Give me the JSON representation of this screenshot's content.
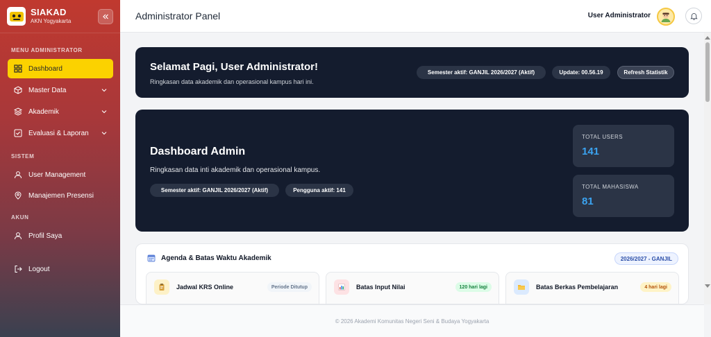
{
  "brand": {
    "title": "SIAKAD",
    "subtitle": "AKN Yogyakarta"
  },
  "sidebar": {
    "sections": [
      {
        "label": "MENU ADMINISTRATOR"
      },
      {
        "label": "SISTEM"
      },
      {
        "label": "AKUN"
      }
    ],
    "items": [
      {
        "label": "Dashboard",
        "icon": "grid-icon",
        "active": true
      },
      {
        "label": "Master Data",
        "icon": "box-icon",
        "expandable": true
      },
      {
        "label": "Akademik",
        "icon": "layers-icon",
        "expandable": true
      },
      {
        "label": "Evaluasi & Laporan",
        "icon": "checkbox-icon",
        "expandable": true
      },
      {
        "label": "User Management",
        "icon": "user-icon"
      },
      {
        "label": "Manajemen Presensi",
        "icon": "location-pin-icon"
      },
      {
        "label": "Profil Saya",
        "icon": "user-icon"
      },
      {
        "label": "Logout",
        "icon": "logout-icon"
      }
    ]
  },
  "header": {
    "title": "Administrator Panel",
    "user": "User Administrator"
  },
  "greeting": {
    "title": "Selamat Pagi, User Administrator!",
    "subtitle": "Ringkasan data akademik dan operasional kampus hari ini.",
    "semester": "Semester aktif: GANJIL 2026/2027 (Aktif)",
    "update": "Update: 00.56.19",
    "refresh_label": "Refresh Statistik"
  },
  "dashboard": {
    "title": "Dashboard Admin",
    "subtitle": "Ringkasan data inti akademik dan operasional kampus.",
    "semester": "Semester aktif: GANJIL 2026/2027 (Aktif)",
    "active_users": "Pengguna aktif: 141",
    "stats": [
      {
        "label": "TOTAL USERS",
        "value": "141"
      },
      {
        "label": "TOTAL MAHASISWA",
        "value": "81"
      }
    ]
  },
  "agenda": {
    "title": "Agenda & Batas Waktu Akademik",
    "badge": "2026/2027 - GANJIL",
    "items": [
      {
        "title": "Jadwal KRS Online",
        "tag": "Periode Ditutup",
        "tag_color": "#64748b",
        "tag_bg": "#f1f5f9",
        "icon_bg": "#fdf1c7"
      },
      {
        "title": "Batas Input Nilai",
        "tag": "120 hari lagi",
        "tag_color": "#15803d",
        "tag_bg": "#dcfce7",
        "icon_bg": "#fde2e4"
      },
      {
        "title": "Batas Berkas Pembelajaran",
        "tag": "4 hari lagi",
        "tag_color": "#b45309",
        "tag_bg": "#fef3c7",
        "icon_bg": "#dbeafe"
      }
    ]
  },
  "footer": {
    "text": "© 2026 Akademi Komunitas Negeri Seni & Budaya Yogyakarta"
  }
}
